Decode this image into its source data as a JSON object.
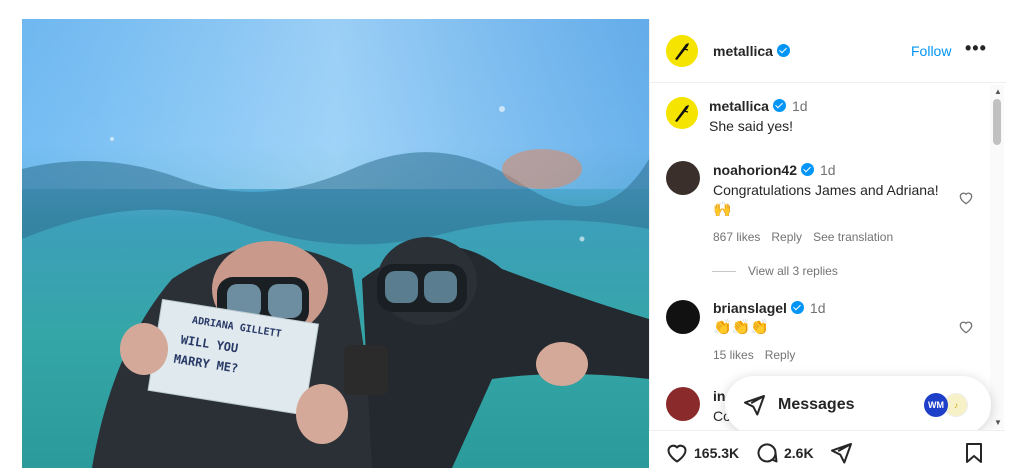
{
  "nav": {
    "items": [
      {
        "icon": "instagram-logo-icon"
      },
      {
        "icon": "home-icon"
      },
      {
        "icon": "reels-icon"
      },
      {
        "icon": "explore-send-icon"
      },
      {
        "icon": "search-icon"
      },
      {
        "icon": "compass-icon"
      },
      {
        "icon": "heart-icon",
        "has_notification": true
      },
      {
        "icon": "plus-icon"
      }
    ]
  },
  "post": {
    "image_sign_text": [
      "ADRIANA GILLETT",
      "WILL YOU",
      "MARRY ME?"
    ],
    "author": {
      "username": "metallica",
      "verified": true,
      "follow_label": "Follow",
      "more_label": "•••"
    }
  },
  "comments": [
    {
      "username": "metallica",
      "time": "1d",
      "text": "She said yes!",
      "is_caption": true
    },
    {
      "username": "noahorion42",
      "time": "1d",
      "text": "Congratulations James and Adriana!",
      "emoji": "🙌",
      "likes": "867 likes",
      "reply_label": "Reply",
      "translate_label": "See translation",
      "view_replies": "View all 3 replies"
    },
    {
      "username": "brianslagel",
      "time": "1d",
      "emoji": "👏👏👏",
      "likes": "15 likes",
      "reply_label": "Reply"
    },
    {
      "username": "in",
      "text": "Co"
    }
  ],
  "messages": {
    "label": "Messages",
    "avatar_text": "WM"
  },
  "actions": {
    "like_count": "165.3K",
    "comment_count": "2.6K"
  },
  "colors": {
    "accent": "#0095f6",
    "logo_yellow": "#f5e400",
    "notification": "#ff3040"
  }
}
